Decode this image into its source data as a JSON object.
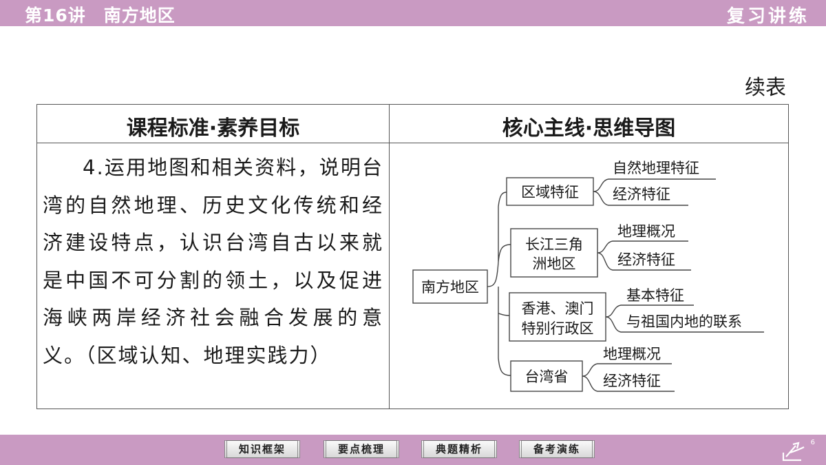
{
  "header": {
    "lesson_no": "第16讲",
    "lesson_title": "南方地区",
    "section": "复习讲练"
  },
  "continued_label": "续表",
  "table": {
    "col1_header": "课程标准·素养目标",
    "col2_header": "核心主线·思维导图",
    "standard_text": "4.运用地图和相关资料，说明台湾的自然地理、历史文化传统和经济建设特点，认识台湾自古以来就是中国不可分割的领土，以及促进海峡两岸经济社会融合发展的意义。（区域认知、地理实践力）"
  },
  "mindmap": {
    "root": "南方地区",
    "branches": [
      {
        "label_lines": [
          "区域特征"
        ],
        "leaves": [
          "自然地理特征",
          "经济特征"
        ]
      },
      {
        "label_lines": [
          "长江三角",
          "洲地区"
        ],
        "leaves": [
          "地理概况",
          "经济特征"
        ]
      },
      {
        "label_lines": [
          "香港、澳门",
          "特别行政区"
        ],
        "leaves": [
          "基本特征",
          "与祖国内地的联系"
        ]
      },
      {
        "label_lines": [
          "台湾省"
        ],
        "leaves": [
          "地理概况",
          "经济特征"
        ]
      }
    ]
  },
  "footer": {
    "nav": [
      "知识框架",
      "要点梳理",
      "典题精析",
      "备考演练"
    ],
    "page_number": "6"
  }
}
